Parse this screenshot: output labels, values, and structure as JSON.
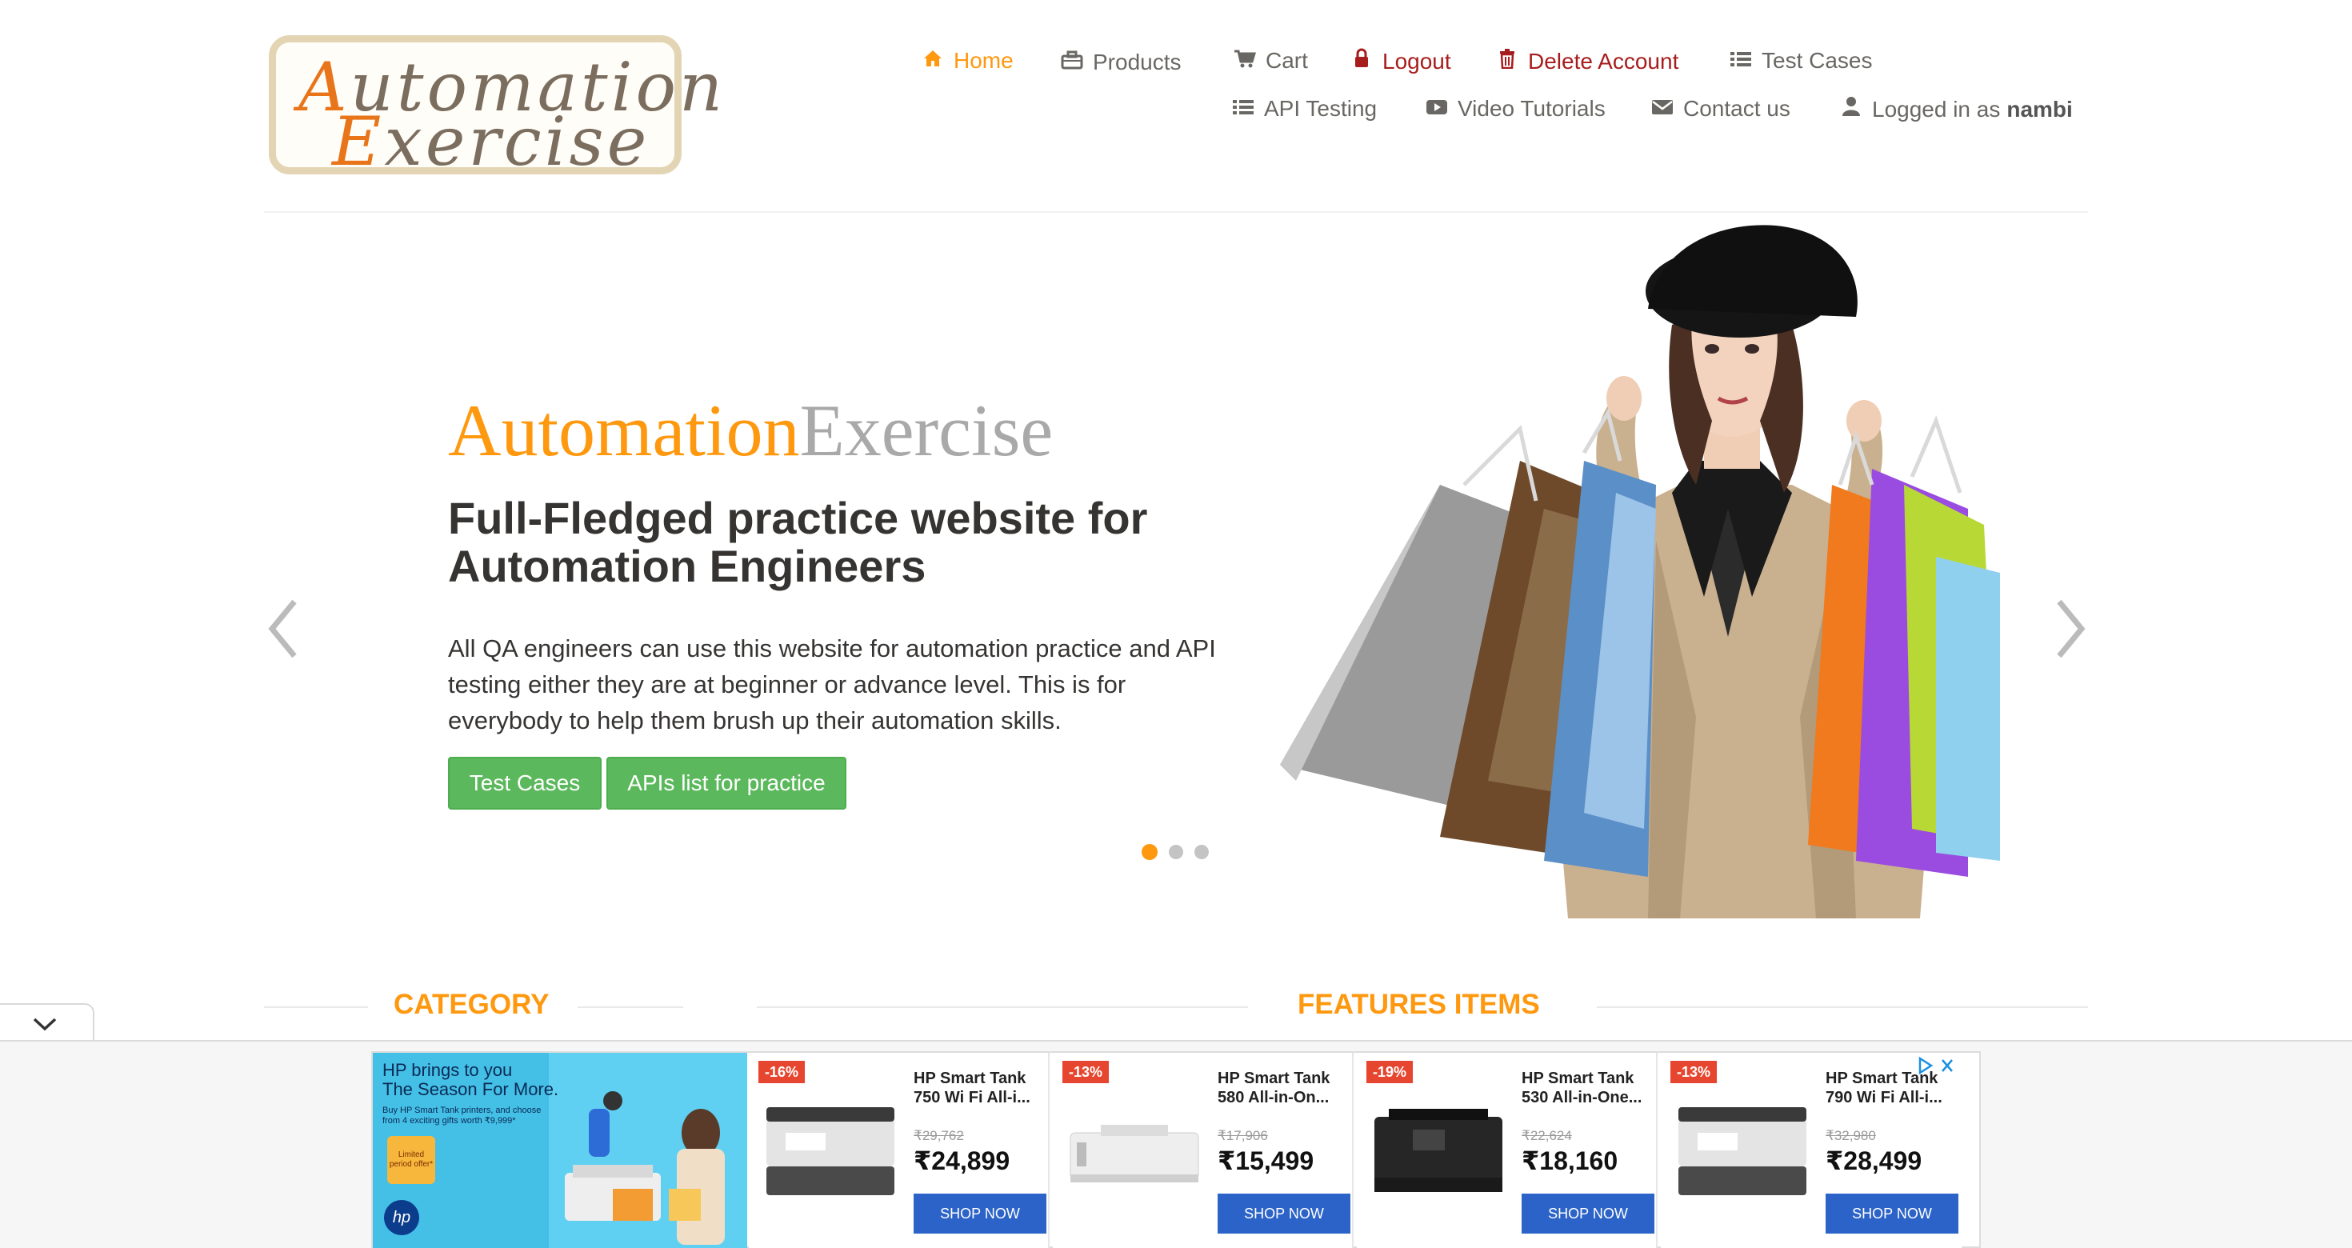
{
  "logo": {
    "line1_cap": "A",
    "line1_rest": "utomation",
    "line2_cap": "E",
    "line2_rest": "xercise"
  },
  "nav": {
    "row1": [
      {
        "label": "Home",
        "icon": "home-icon"
      },
      {
        "label": "Products",
        "icon": "briefcase-icon"
      },
      {
        "label": "Cart",
        "icon": "cart-icon"
      },
      {
        "label": "Logout",
        "icon": "lock-icon"
      },
      {
        "label": "Delete Account",
        "icon": "trash-icon"
      },
      {
        "label": "Test Cases",
        "icon": "list-icon"
      }
    ],
    "row2": [
      {
        "label": "API Testing",
        "icon": "list-icon"
      },
      {
        "label": "Video Tutorials",
        "icon": "youtube-icon"
      },
      {
        "label": "Contact us",
        "icon": "envelope-icon"
      },
      {
        "label": "Logged in as",
        "icon": "user-icon",
        "username": "nambi"
      }
    ]
  },
  "hero": {
    "brand_part1": "Automation",
    "brand_part2": "Exercise",
    "title": "Full-Fledged practice website for Automation Engineers",
    "text": "All QA engineers can use this website for automation practice and API testing either they are at beginner or advance level. This is for everybody to help them brush up their automation skills.",
    "btn_test_cases": "Test Cases",
    "btn_apis": "APIs list for practice",
    "active_slide": 1,
    "slide_count": 3
  },
  "sections": {
    "category": "CATEGORY",
    "features": "FEATURES ITEMS"
  },
  "ad": {
    "headline_1": "HP brings to you",
    "headline_2": "The Season For More.",
    "sub": "Buy HP Smart Tank printers, and choose from 4 exciting gifts worth ₹9,999*",
    "limited": "Limited period offer*",
    "brand": "hp",
    "products": [
      {
        "discount": "-16%",
        "name": "HP Smart Tank 750 Wi Fi All-i...",
        "old": "₹29,762",
        "price": "₹24,899",
        "cta": "SHOP NOW"
      },
      {
        "discount": "-13%",
        "name": "HP Smart Tank 580 All-in-On...",
        "old": "₹17,906",
        "price": "₹15,499",
        "cta": "SHOP NOW"
      },
      {
        "discount": "-19%",
        "name": "HP Smart Tank 530 All-in-One...",
        "old": "₹22,624",
        "price": "₹18,160",
        "cta": "SHOP NOW"
      },
      {
        "discount": "-13%",
        "name": "HP Smart Tank 790 Wi Fi All-i...",
        "old": "₹32,980",
        "price": "₹28,499",
        "cta": "SHOP NOW"
      }
    ]
  },
  "colors": {
    "accent": "#fe980f",
    "danger": "#a71d1d",
    "button": "#5cb85c",
    "ad_cta": "#2c63c8"
  }
}
